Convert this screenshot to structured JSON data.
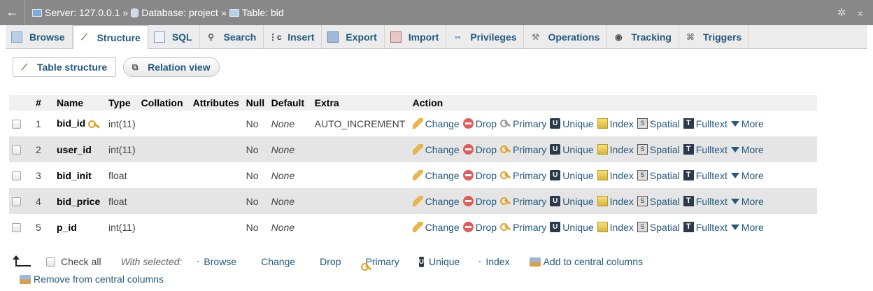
{
  "breadcrumb": {
    "back_icon": "back-arrow-icon",
    "server": "Server: 127.0.0.1",
    "database": "Database: project",
    "table": "Table: bid",
    "separator": "»"
  },
  "top_icons": [
    "gear-icon",
    "collapse-icon"
  ],
  "tabs": [
    {
      "label": "Browse",
      "icon": "browse-icon",
      "active": false
    },
    {
      "label": "Structure",
      "icon": "structure-icon",
      "active": true
    },
    {
      "label": "SQL",
      "icon": "sql-icon",
      "active": false
    },
    {
      "label": "Search",
      "icon": "search-icon",
      "active": false
    },
    {
      "label": "Insert",
      "icon": "insert-icon",
      "active": false
    },
    {
      "label": "Export",
      "icon": "export-icon",
      "active": false
    },
    {
      "label": "Import",
      "icon": "import-icon",
      "active": false
    },
    {
      "label": "Privileges",
      "icon": "privileges-icon",
      "active": false
    },
    {
      "label": "Operations",
      "icon": "operations-icon",
      "active": false
    },
    {
      "label": "Tracking",
      "icon": "tracking-icon",
      "active": false
    },
    {
      "label": "Triggers",
      "icon": "triggers-icon",
      "active": false
    }
  ],
  "subtabs": [
    {
      "label": "Table structure",
      "active": true
    },
    {
      "label": "Relation view",
      "active": false
    }
  ],
  "table": {
    "headers": [
      "#",
      "Name",
      "Type",
      "Collation",
      "Attributes",
      "Null",
      "Default",
      "Extra",
      "Action"
    ],
    "rows": [
      {
        "num": "1",
        "name": "bid_id",
        "primary_key": true,
        "type": "int(11)",
        "collation": "",
        "attributes": "",
        "null": "No",
        "default": "None",
        "extra": "AUTO_INCREMENT"
      },
      {
        "num": "2",
        "name": "user_id",
        "primary_key": false,
        "type": "int(11)",
        "collation": "",
        "attributes": "",
        "null": "No",
        "default": "None",
        "extra": ""
      },
      {
        "num": "3",
        "name": "bid_init",
        "primary_key": false,
        "type": "float",
        "collation": "",
        "attributes": "",
        "null": "No",
        "default": "None",
        "extra": ""
      },
      {
        "num": "4",
        "name": "bid_price",
        "primary_key": false,
        "type": "float",
        "collation": "",
        "attributes": "",
        "null": "No",
        "default": "None",
        "extra": ""
      },
      {
        "num": "5",
        "name": "p_id",
        "primary_key": false,
        "type": "int(11)",
        "collation": "",
        "attributes": "",
        "null": "No",
        "default": "None",
        "extra": ""
      }
    ],
    "actions": {
      "change": "Change",
      "drop": "Drop",
      "primary": "Primary",
      "unique": "Unique",
      "index": "Index",
      "spatial": "Spatial",
      "fulltext": "Fulltext",
      "more": "More"
    }
  },
  "footer": {
    "check_all": "Check all",
    "with_selected": "With selected:",
    "browse": "Browse",
    "change": "Change",
    "drop": "Drop",
    "primary": "Primary",
    "unique": "Unique",
    "index": "Index",
    "add_central": "Add to central columns",
    "remove_central": "Remove from central columns"
  },
  "colors": {
    "link": "#235a81",
    "topbar": "#888888",
    "row_even": "#e5e5e5",
    "drop": "#e25a5a",
    "key": "#e0a520"
  }
}
